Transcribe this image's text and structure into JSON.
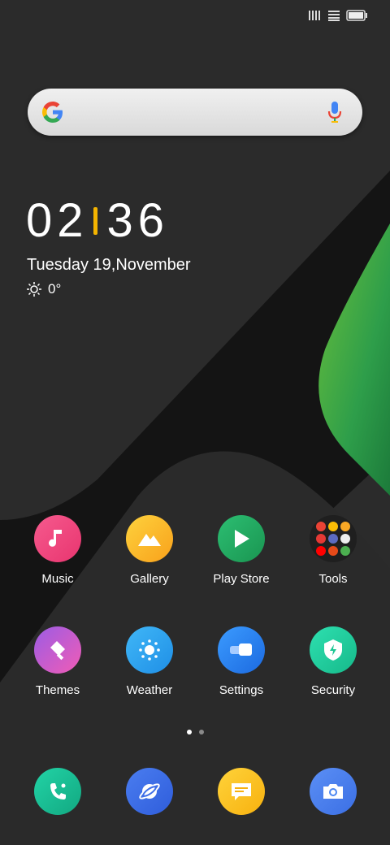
{
  "clock": {
    "hours": "02",
    "minutes": "36"
  },
  "date": "Tuesday 19,November",
  "weather": {
    "temperature": "0°"
  },
  "apps_row1": [
    {
      "label": "Music"
    },
    {
      "label": "Gallery"
    },
    {
      "label": "Play Store"
    },
    {
      "label": "Tools"
    }
  ],
  "apps_row2": [
    {
      "label": "Themes"
    },
    {
      "label": "Weather"
    },
    {
      "label": "Settings"
    },
    {
      "label": "Security"
    }
  ],
  "page_indicator": {
    "pages": 2,
    "current": 1
  },
  "colors": {
    "music": "#f1477e",
    "gallery": "#fbb81c",
    "play_store": "#23a862",
    "themes": "#c04ec9",
    "weather": "#2fa6f2",
    "settings": "#2e86f0",
    "security": "#1dd3a0",
    "phone": "#1bc6a0",
    "browser": "#3f6fe8",
    "messages": "#fbc21e",
    "camera": "#4a86f2",
    "clock_separator": "#f4b400"
  }
}
